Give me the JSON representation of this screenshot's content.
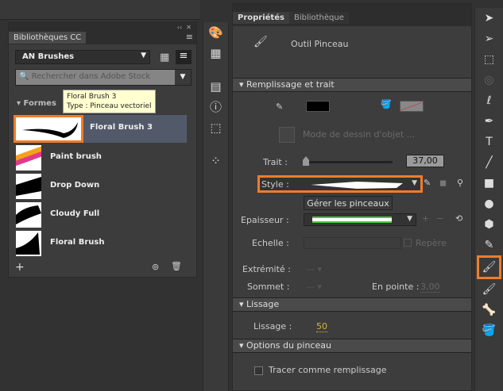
{
  "library": {
    "tab": "Bibliothèques CC",
    "collapse": "‹‹",
    "close": "✕",
    "selected_library": "AN Brushes",
    "search_placeholder": "Rechercher dans Adobe Stock",
    "group": "Formes",
    "tooltip": {
      "name": "Floral Brush 3",
      "type": "Type : Pinceau vectoriel"
    },
    "items": [
      {
        "label": "Floral Brush 3"
      },
      {
        "label": "Paint brush"
      },
      {
        "label": "Drop Down"
      },
      {
        "label": "Cloudy Full"
      },
      {
        "label": "Floral Brush"
      }
    ]
  },
  "properties": {
    "tabs": [
      "Propriétés",
      "Bibliothèque"
    ],
    "tool_name": "Outil Pinceau",
    "fill_stroke": {
      "title": "Remplissage et trait",
      "object_mode": "Mode de dessin d'objet ...",
      "stroke_label": "Trait :",
      "stroke_value": "37,00",
      "stroke_slider": 0.05,
      "style_label": "Style :",
      "manage_brushes": "Gérer les pinceaux",
      "width_label": "Epaisseur :",
      "scale_label": "Echelle :",
      "hinting_label": "Repère",
      "cap_label": "Extrémité :",
      "join_label": "Sommet :",
      "miter_label": "En pointe :",
      "miter_value": "3,00"
    },
    "smoothing": {
      "title": "Lissage",
      "label": "Lissage :",
      "value": "50"
    },
    "brush_options": {
      "title": "Options du pinceau",
      "draw_as_fill": "Tracer comme remplissage"
    }
  },
  "colors": {
    "accent": "#f07c2a",
    "selected_row": "#525a6a",
    "smoothing_value": "#d9b23a"
  }
}
